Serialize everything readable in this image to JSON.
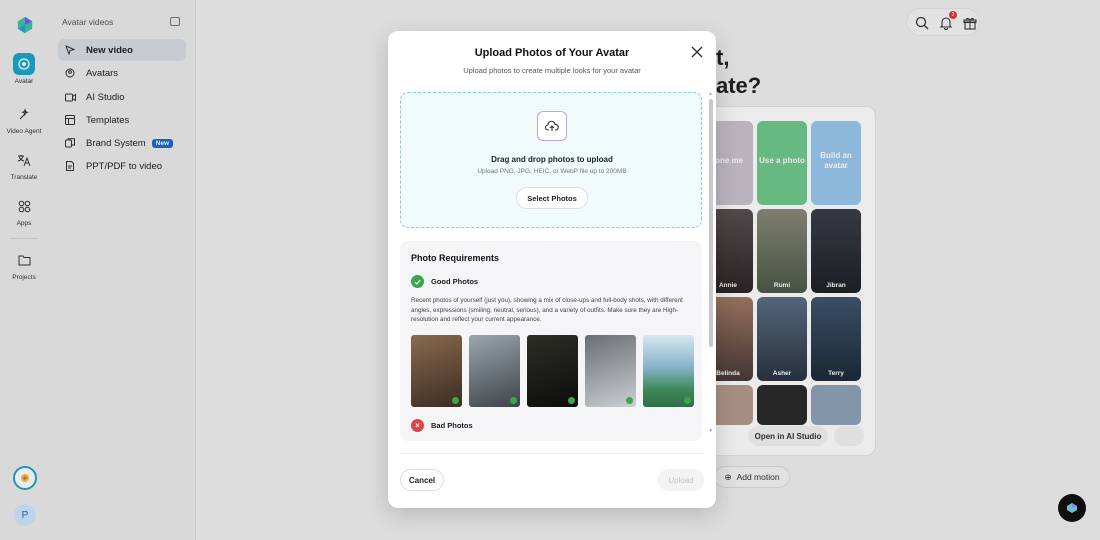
{
  "rail": {
    "items": [
      {
        "label": "Avatar",
        "icon": "avatar-icon"
      },
      {
        "label": "Video Agent",
        "icon": "video-agent-icon"
      },
      {
        "label": "Translate",
        "icon": "translate-icon"
      },
      {
        "label": "Apps",
        "icon": "apps-icon"
      },
      {
        "label": "Projects",
        "icon": "folder-icon"
      }
    ],
    "user_initial": "P"
  },
  "sidebar": {
    "heading": "Avatar videos",
    "items": [
      {
        "label": "New video"
      },
      {
        "label": "Avatars"
      },
      {
        "label": "AI Studio"
      },
      {
        "label": "Templates"
      },
      {
        "label": "Brand System",
        "badge": "New"
      },
      {
        "label": "PPT/PDF to video"
      }
    ]
  },
  "header": {
    "notification_count": "2"
  },
  "background": {
    "hero_line1": "t,",
    "hero_line2": "ate?",
    "tiles": {
      "clone": "lone me",
      "use_photo": "Use a photo",
      "build": "Build an avatar",
      "names": [
        "Annie",
        "Rumi",
        "Jibran",
        "Belinda",
        "Asher",
        "Terry"
      ]
    },
    "open_ai_studio": "Open in AI Studio",
    "add_motion": "Add motion"
  },
  "modal": {
    "title": "Upload Photos of Your Avatar",
    "subtitle": "Upload photos to create multiple looks for your avatar",
    "dropzone": {
      "title": "Drag and drop photos to upload",
      "subtitle": "Upload PNG, JPG, HEIC, or WebP file up to 200MB",
      "button": "Select Photos"
    },
    "requirements": {
      "title": "Photo Requirements",
      "good_title": "Good Photos",
      "good_desc": "Recent photos of yourself (just you), showing a mix of close-ups and full-body shots, with different angles, expressions (smiling, neutral, serious), and a variety of outfits. Make sure they are High-resolution and reflect your current appearance.",
      "bad_title": "Bad Photos"
    },
    "cancel": "Cancel",
    "upload": "Upload"
  },
  "colors": {
    "accent": "#1aa7c9",
    "good": "#3aa64b",
    "bad": "#e04444",
    "dropzone_bg": "#f1fbfc",
    "dropzone_border": "#7ad0dd"
  }
}
